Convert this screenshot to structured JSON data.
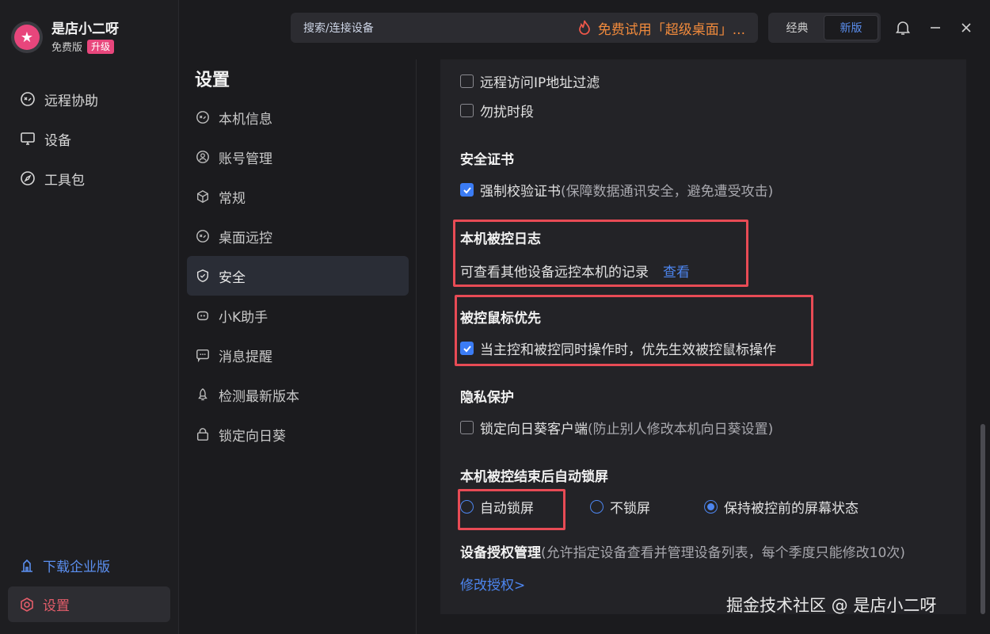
{
  "brand": {
    "name": "是店小二呀",
    "plan": "免费版",
    "upgrade": "升级"
  },
  "sidebar": {
    "items": [
      {
        "label": "远程协助",
        "icon": "remote-icon"
      },
      {
        "label": "设备",
        "icon": "monitor-icon"
      },
      {
        "label": "工具包",
        "icon": "compass-icon"
      }
    ],
    "download": "下载企业版",
    "settings": "设置"
  },
  "topbar": {
    "search_placeholder": "搜索/连接设备",
    "promo": "免费试用「超级桌面」...",
    "mode_classic": "经典",
    "mode_new": "新版"
  },
  "settings_menu": {
    "title": "设置",
    "items": [
      {
        "label": "本机信息",
        "icon": "remote-icon"
      },
      {
        "label": "账号管理",
        "icon": "user-icon"
      },
      {
        "label": "常规",
        "icon": "cube-icon"
      },
      {
        "label": "桌面远控",
        "icon": "remote-icon"
      },
      {
        "label": "安全",
        "icon": "shield-icon",
        "active": true
      },
      {
        "label": "小K助手",
        "icon": "bot-icon"
      },
      {
        "label": "消息提醒",
        "icon": "message-icon"
      },
      {
        "label": "检测最新版本",
        "icon": "rocket-icon"
      },
      {
        "label": "锁定向日葵",
        "icon": "lock-icon"
      }
    ]
  },
  "content": {
    "top_options": [
      {
        "label": "远程访问IP地址过滤",
        "checked": false
      },
      {
        "label": "勿扰时段",
        "checked": false
      }
    ],
    "cert": {
      "title": "安全证书",
      "option_label": "强制校验证书",
      "option_hint": "(保障数据通讯安全，避免遭受攻击)",
      "checked": true
    },
    "log": {
      "title": "本机被控日志",
      "desc": "可查看其他设备远控本机的记录",
      "link": "查看"
    },
    "mouse": {
      "title": "被控鼠标优先",
      "option_label": "当主控和被控同时操作时，优先生效被控鼠标操作",
      "checked": true
    },
    "privacy": {
      "title": "隐私保护",
      "option_label": "锁定向日葵客户端",
      "option_hint": "(防止别人修改本机向日葵设置)",
      "checked": false
    },
    "autolock": {
      "title": "本机被控结束后自动锁屏",
      "options": [
        {
          "label": "自动锁屏",
          "selected": false
        },
        {
          "label": "不锁屏",
          "selected": false
        },
        {
          "label": "保持被控前的屏幕状态",
          "selected": true
        }
      ]
    },
    "auth": {
      "title": "设备授权管理",
      "hint": "(允许指定设备查看并管理设备列表，每个季度只能修改10次)",
      "link": "修改授权>"
    }
  },
  "watermark": "掘金技术社区 @ 是店小二呀",
  "colors": {
    "accent": "#4d86f0",
    "brand": "#e8467c",
    "highlight": "#e84b55",
    "promo": "#f08a3c"
  }
}
